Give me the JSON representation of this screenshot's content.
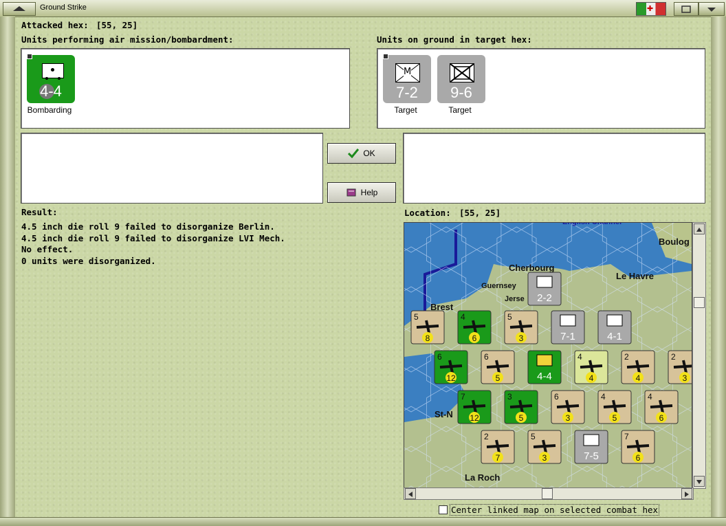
{
  "window": {
    "title": "Ground Strike"
  },
  "attacked_hex": {
    "label": "Attacked hex:",
    "value": "[55, 25]"
  },
  "air_units": {
    "heading": "Units performing air mission/bombardment:",
    "items": [
      {
        "strength": "4-4",
        "caption": "Bombarding",
        "color": "#1a9a1a"
      }
    ]
  },
  "ground_units": {
    "heading": "Units on ground in target hex:",
    "items": [
      {
        "strength": "7-2",
        "caption": "Target",
        "symbol_letter": "M",
        "color": "#a9a9a9"
      },
      {
        "strength": "9-6",
        "caption": "Target",
        "symbol_letter": "",
        "color": "#a9a9a9"
      }
    ]
  },
  "buttons": {
    "ok": "OK",
    "help": "Help"
  },
  "result": {
    "heading": "Result:",
    "lines": [
      "4.5 inch die roll 9 failed to disorganize Berlin.",
      "4.5 inch die roll 9 failed to disorganize LVI Mech.",
      "No effect.",
      "0 units were disorganized."
    ]
  },
  "location": {
    "label": "Location:",
    "value": "[55, 25]"
  },
  "map": {
    "places": [
      "English Channel",
      "Boulog",
      "Cherbourg",
      "Le Havre",
      "Guernsey",
      "Jerse",
      "Brest",
      "St-N",
      "La Roch"
    ],
    "counters": [
      {
        "strength": "2-2",
        "type": "ground",
        "letter": "M"
      },
      {
        "strength": "8",
        "type": "air",
        "top": "5"
      },
      {
        "strength": "6",
        "type": "air-green",
        "top": "4"
      },
      {
        "strength": "3",
        "type": "air",
        "top": "5"
      },
      {
        "strength": "7-1",
        "type": "ground"
      },
      {
        "strength": "4-1",
        "type": "ground"
      },
      {
        "strength": "12",
        "type": "air-green",
        "top": "6"
      },
      {
        "strength": "5",
        "type": "air",
        "top": "6"
      },
      {
        "strength": "4-4",
        "type": "bomber-green"
      },
      {
        "strength": "4",
        "type": "air-light",
        "top": "4"
      },
      {
        "strength": "4",
        "type": "air",
        "top": "2"
      },
      {
        "strength": "3",
        "type": "air",
        "top": "2"
      },
      {
        "strength": "12",
        "type": "air-green",
        "top": "7"
      },
      {
        "strength": "5",
        "type": "air-green",
        "top": "3"
      },
      {
        "strength": "3",
        "type": "air",
        "top": "6"
      },
      {
        "strength": "5",
        "type": "air",
        "top": "4"
      },
      {
        "strength": "6",
        "type": "air",
        "top": "4"
      },
      {
        "strength": "7",
        "type": "air",
        "top": "2"
      },
      {
        "strength": "3",
        "type": "air",
        "top": "5"
      },
      {
        "strength": "7-5",
        "type": "ground"
      },
      {
        "strength": "6",
        "type": "air",
        "top": "7"
      }
    ]
  },
  "checkbox": {
    "label": "Center linked map on selected combat hex",
    "checked": false
  },
  "colors": {
    "background": "#cbd7a6",
    "sea": "#3b7fc1",
    "land": "#b9c48c",
    "air_counter": "#d7c39a",
    "green_counter": "#1a9a1a"
  }
}
